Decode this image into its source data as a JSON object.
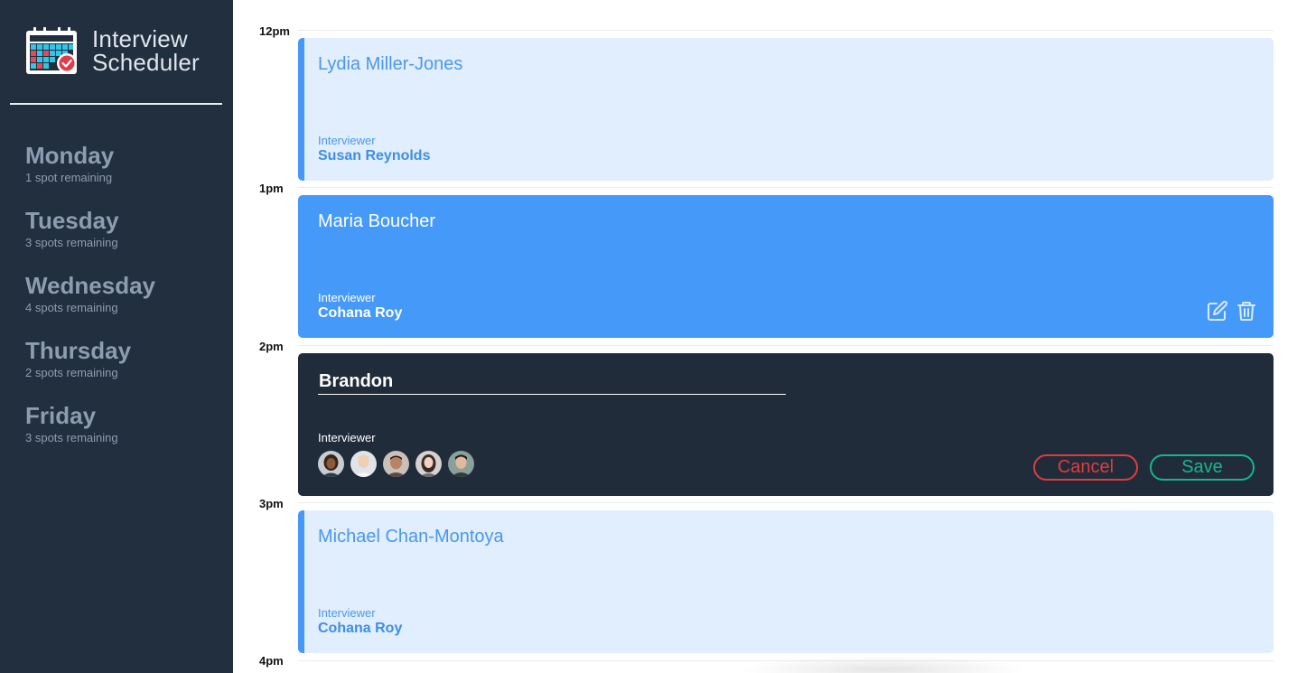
{
  "brand": {
    "line1": "Interview",
    "line2": "Scheduler",
    "logo_icon": "calendar-check-icon"
  },
  "days": [
    {
      "name": "Monday",
      "spots": "1 spot remaining"
    },
    {
      "name": "Tuesday",
      "spots": "3 spots remaining"
    },
    {
      "name": "Wednesday",
      "spots": "4 spots remaining"
    },
    {
      "name": "Thursday",
      "spots": "2 spots remaining"
    },
    {
      "name": "Friday",
      "spots": "3 spots remaining"
    }
  ],
  "hours": [
    "12pm",
    "1pm",
    "2pm",
    "3pm",
    "4pm"
  ],
  "appointments": [
    {
      "student": "Lydia Miller-Jones",
      "interviewer_label": "Interviewer",
      "interviewer": "Susan Reynolds"
    },
    {
      "student": "Maria Boucher",
      "interviewer_label": "Interviewer",
      "interviewer": "Cohana Roy",
      "actions": [
        "edit-icon",
        "trash-icon"
      ]
    },
    {
      "student": "Michael Chan-Montoya",
      "interviewer_label": "Interviewer",
      "interviewer": "Cohana Roy"
    }
  ],
  "form": {
    "student_value": "Brandon",
    "interviewer_label": "Interviewer",
    "cancel_label": "Cancel",
    "save_label": "Save"
  },
  "colors": {
    "sidebar": "#222f3e",
    "accent_blue": "#4599f9",
    "light_blue": "#e1eefd",
    "cancel": "#e03c3c",
    "save": "#16b68a"
  }
}
